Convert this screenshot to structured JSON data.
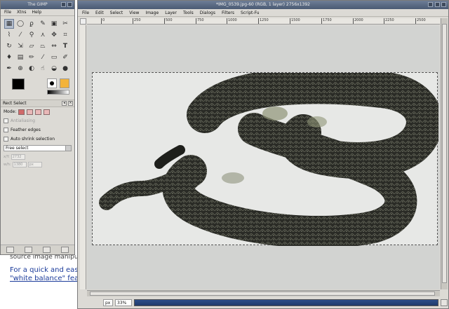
{
  "background_page": {
    "line0": "source image manipulation",
    "line1": "For a quick and easy c",
    "line2": "\"white balance\" featur"
  },
  "toolbox": {
    "title": "The GIMP",
    "menu": [
      "File",
      "Xtns",
      "Help"
    ],
    "tool_icons": [
      "rect-select",
      "ellipse-select",
      "free-select",
      "fuzzy-select",
      "by-color-select",
      "scissors",
      "paths",
      "color-picker",
      "zoom",
      "measure",
      "move",
      "crop",
      "rotate",
      "scale",
      "shear",
      "perspective",
      "flip",
      "text",
      "bucket-fill",
      "blend",
      "pencil",
      "paintbrush",
      "eraser",
      "airbrush",
      "ink",
      "clone",
      "heal",
      "smudge",
      "dodge-burn",
      "convolve"
    ],
    "options_title": "Rect Select",
    "mode_label": "Mode:",
    "antialiasing": "Antialiasing",
    "feather_edges": "Feather edges",
    "auto_shrink": "Auto shrink selection",
    "free_select": "Free select",
    "pos_x": "2732",
    "pos_y": "1380",
    "unit": "px"
  },
  "image_window": {
    "title": "*IMG_0539.jpg-60 (RGB, 1 layer) 2756x1392",
    "menu": [
      "File",
      "Edit",
      "Select",
      "View",
      "Image",
      "Layer",
      "Tools",
      "Dialogs",
      "Filters",
      "Script-Fu"
    ],
    "hruler_ticks": [
      "0",
      "250",
      "500",
      "750",
      "1000",
      "1250",
      "1500",
      "1750",
      "2000",
      "2250",
      "2500"
    ],
    "status_unit": "px",
    "status_zoom": "33%"
  },
  "colors": {
    "fg": "#000000",
    "bg": "#ffffff"
  }
}
